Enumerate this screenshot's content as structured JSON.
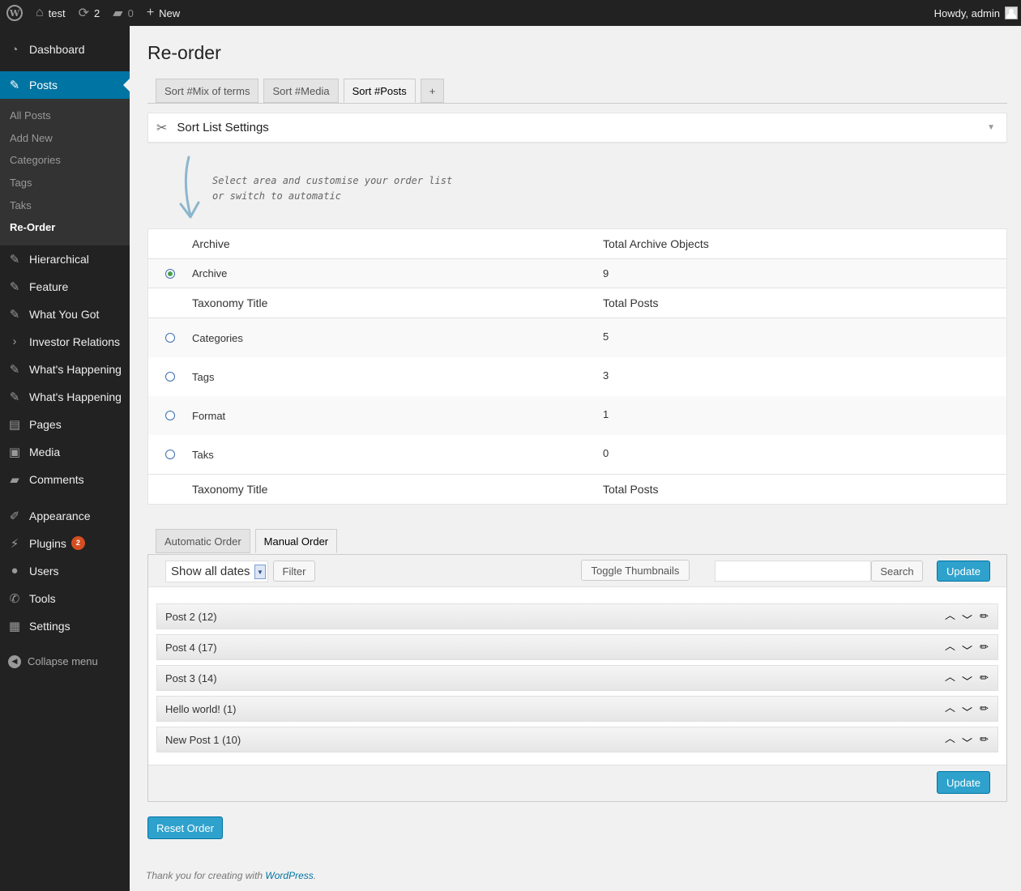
{
  "adminbar": {
    "site_name": "test",
    "updates_count": "2",
    "comments_count": "0",
    "new_label": "New",
    "howdy": "Howdy, admin"
  },
  "sidebar": {
    "dashboard": "Dashboard",
    "posts": "Posts",
    "posts_submenu": [
      "All Posts",
      "Add New",
      "Categories",
      "Tags",
      "Taks",
      "Re-Order"
    ],
    "hierarchical": "Hierarchical",
    "feature": "Feature",
    "what_you_got": "What You Got",
    "investor_relations": "Investor Relations",
    "whats_happening_1": "What's Happening",
    "whats_happening_2": "What's Happening",
    "pages": "Pages",
    "media": "Media",
    "comments": "Comments",
    "appearance": "Appearance",
    "plugins": "Plugins",
    "plugins_badge": "2",
    "users": "Users",
    "tools": "Tools",
    "settings": "Settings",
    "collapse": "Collapse menu"
  },
  "page": {
    "title": "Re-order",
    "sort_tabs": [
      "Sort #Mix of terms",
      "Sort #Media",
      "Sort #Posts",
      "+"
    ],
    "settings_title": "Sort List Settings",
    "hint_line1": "Select area and customise your order list",
    "hint_line2": "or switch to automatic"
  },
  "archive_table": {
    "header_name": "Archive",
    "header_count": "Total Archive Objects",
    "row_name": "Archive",
    "row_count": "9"
  },
  "taxonomy_table": {
    "header_name": "Taxonomy Title",
    "header_count": "Total Posts",
    "rows": [
      {
        "name": "Categories",
        "count": "5"
      },
      {
        "name": "Tags",
        "count": "3"
      },
      {
        "name": "Format",
        "count": "1"
      },
      {
        "name": "Taks",
        "count": "0"
      }
    ],
    "footer_name": "Taxonomy Title",
    "footer_count": "Total Posts"
  },
  "order": {
    "tabs": [
      "Automatic Order",
      "Manual Order"
    ],
    "date_select": "Show all dates",
    "filter": "Filter",
    "toggle_thumbnails": "Toggle Thumbnails",
    "search_value": "",
    "search_button": "Search",
    "update": "Update",
    "posts": [
      "Post 2 (12)",
      "Post 4 (17)",
      "Post 3 (14)",
      "Hello world! (1)",
      "New Post 1 (10)"
    ],
    "reset": "Reset Order"
  },
  "footer": {
    "prefix": "Thank you for creating with ",
    "link": "WordPress",
    "suffix": "."
  },
  "colors": {
    "accent": "#0074a2",
    "button_primary": "#2ea2cc",
    "sidebar_bg": "#222222",
    "badge": "#d54e21"
  }
}
